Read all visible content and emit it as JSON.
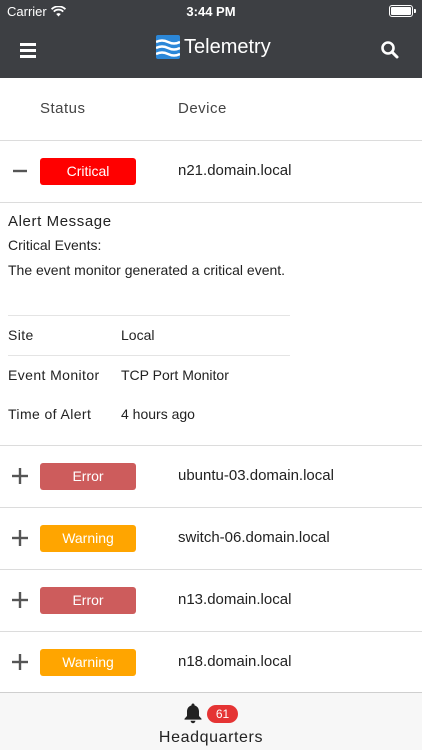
{
  "status_bar": {
    "carrier": "Carrier",
    "time": "3:44 PM"
  },
  "nav": {
    "title": "Telemetry",
    "menu_icon": "hamburger-icon",
    "search_icon": "search-icon",
    "logo_icon": "telemetry-logo-icon"
  },
  "table": {
    "headers": {
      "status": "Status",
      "device": "Device"
    },
    "colors": {
      "Critical": "#ff0000",
      "Error": "#cd5c5c",
      "Warning": "#ffa500"
    },
    "rows": [
      {
        "status": "Critical",
        "device": "n21.domain.local",
        "expanded": true
      },
      {
        "status": "Error",
        "device": "ubuntu-03.domain.local",
        "expanded": false
      },
      {
        "status": "Warning",
        "device": "switch-06.domain.local",
        "expanded": false
      },
      {
        "status": "Error",
        "device": "n13.domain.local",
        "expanded": false
      },
      {
        "status": "Warning",
        "device": "n18.domain.local",
        "expanded": false
      }
    ]
  },
  "detail": {
    "title": "Alert Message",
    "line1": "Critical Events:",
    "line2": "The event monitor generated a critical event.",
    "props": [
      {
        "key": "Site",
        "value": "Local"
      },
      {
        "key": "Event Monitor",
        "value": "TCP Port Monitor"
      },
      {
        "key": "Time of Alert",
        "value": "4 hours ago"
      }
    ]
  },
  "footer": {
    "alert_count": "61",
    "location": "Headquarters",
    "bell_icon": "bell-icon"
  }
}
